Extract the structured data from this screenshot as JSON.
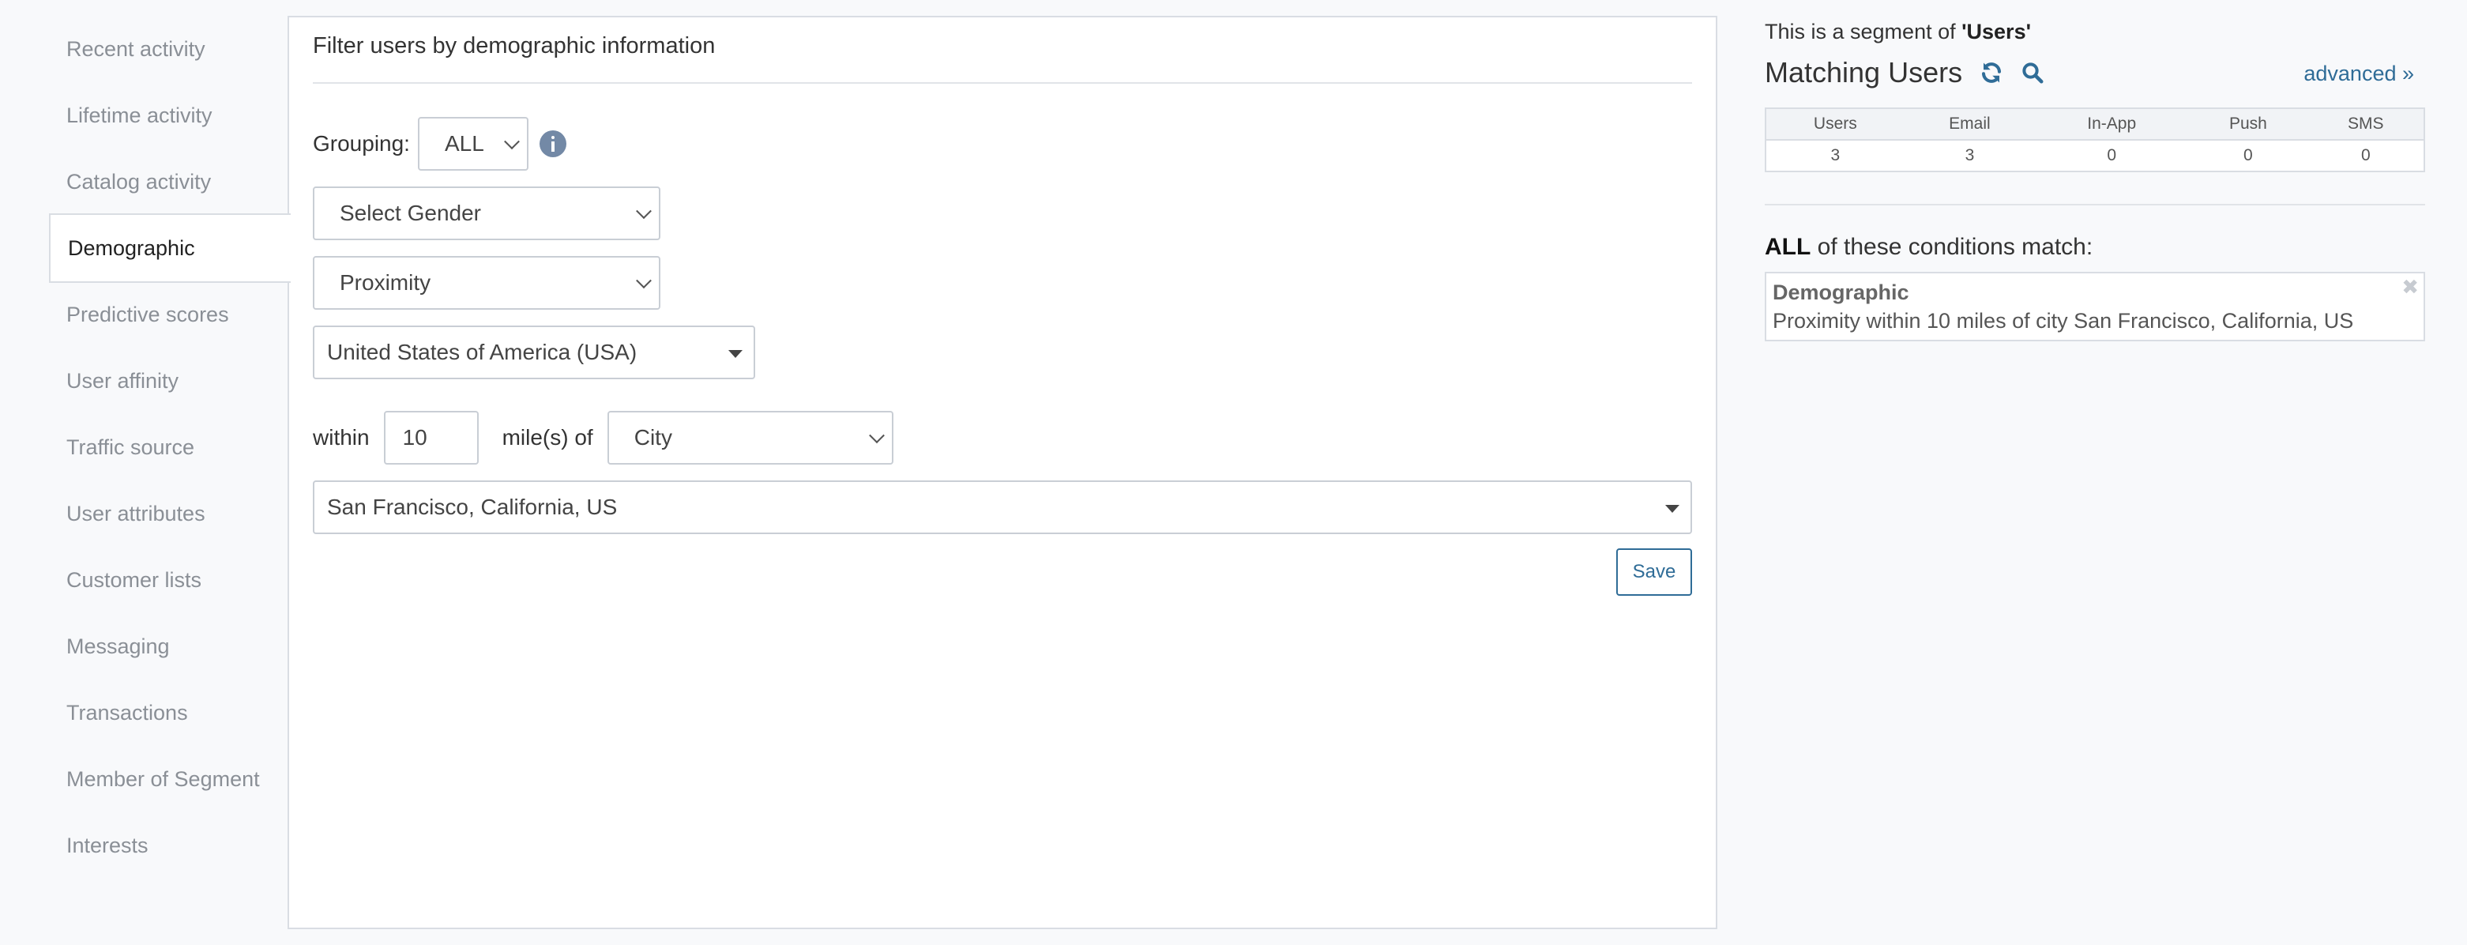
{
  "sidebar": {
    "items": [
      {
        "label": "Recent activity"
      },
      {
        "label": "Lifetime activity"
      },
      {
        "label": "Catalog activity"
      },
      {
        "label": "Demographic",
        "active": true
      },
      {
        "label": "Predictive scores"
      },
      {
        "label": "User affinity"
      },
      {
        "label": "Traffic source"
      },
      {
        "label": "User attributes"
      },
      {
        "label": "Customer lists"
      },
      {
        "label": "Messaging"
      },
      {
        "label": "Transactions"
      },
      {
        "label": "Member of Segment"
      },
      {
        "label": "Interests"
      }
    ]
  },
  "filter": {
    "title": "Filter users by demographic information",
    "grouping_label": "Grouping:",
    "grouping_value": "ALL",
    "gender_value": "Select Gender",
    "type_value": "Proximity",
    "country_value": "United States of America (USA)",
    "within_label": "within",
    "distance_value": "10",
    "miles_label": "mile(s) of",
    "place_type_value": "City",
    "location_value": "San Francisco, California, US",
    "save_label": "Save"
  },
  "summary": {
    "segment_note_prefix": "This is a segment of ",
    "segment_name": "'Users'",
    "matching_title": "Matching Users",
    "advanced_label": "advanced »",
    "stats": {
      "headers": [
        "Users",
        "Email",
        "In-App",
        "Push",
        "SMS"
      ],
      "values": [
        "3",
        "3",
        "0",
        "0",
        "0"
      ]
    },
    "conditions_keyword": "ALL",
    "conditions_rest": " of these conditions match:",
    "condition": {
      "title": "Demographic",
      "description": "Proximity within 10 miles of city San Francisco, California, US"
    },
    "remove_symbol": "✖"
  },
  "colors": {
    "accent": "#2f6c97",
    "info_icon": "#7389a6",
    "border": "#d9dde3",
    "background": "#f8f9fb"
  }
}
